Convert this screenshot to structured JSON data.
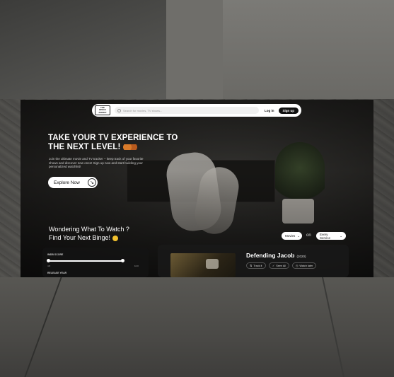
{
  "nav": {
    "logo_lines": [
      "THE",
      "BINGE",
      "ADDICT"
    ],
    "search_placeholder": "Search for movies, TV shows...",
    "login": "Log in",
    "signup": "Sign up"
  },
  "hero": {
    "title": "TAKE YOUR TV EXPERIENCE TO THE NEXT LEVEL!",
    "subtitle": "Join the ultimate movie and TV tracker – keep track of your favorite shows and discover new ones! Sign up now and start building your personalized watchlist!",
    "cta": "Explore Now"
  },
  "discover": {
    "heading_line1": "Wondering What To Watch ?",
    "heading_line2": "Find Your Next Binge!",
    "type_select": "Movies",
    "on_label": "on",
    "service_select": "Every Service"
  },
  "filters": {
    "imdb_label": "IMDB SCORE",
    "imdb_min": "4.8",
    "imdb_max": "10.0",
    "imdb_range_fraction": [
      0.0,
      1.0
    ],
    "release_label": "RELEASE YEAR"
  },
  "result": {
    "title": "Defending Jacob",
    "year": "(2020)",
    "actions": [
      "Track it",
      "Seen All",
      "Watch later"
    ]
  },
  "colors": {
    "accent_dark": "#111111",
    "panel_bg": "#1e1e1e"
  }
}
